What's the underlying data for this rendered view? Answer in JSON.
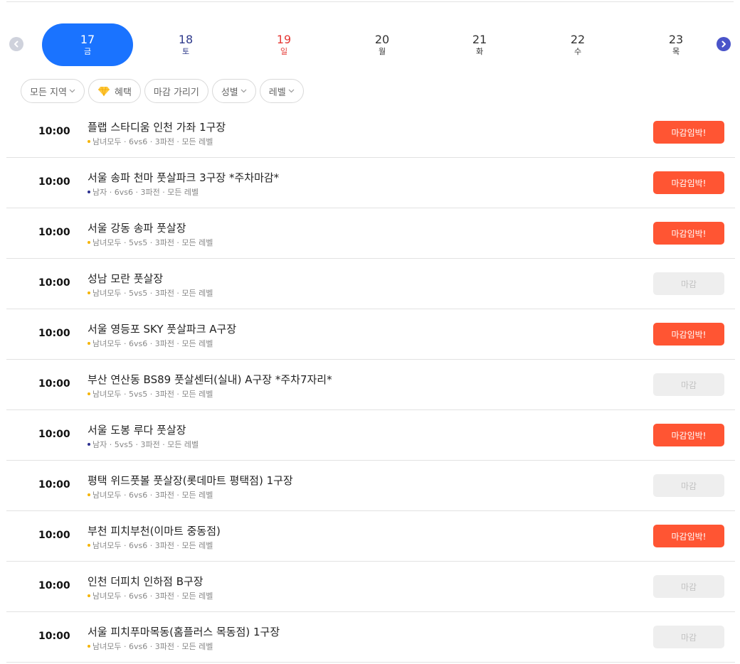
{
  "colors": {
    "selected_day": "#1a73ff",
    "saturday": "#2f3b8c",
    "sunday": "#e53935",
    "urgent": "#ff5533",
    "closed_bg": "#eeeeee",
    "mixed_dot": "#f5b400",
    "male_dot": "#2b2f8f"
  },
  "date_nav": {
    "prev_icon": "chevron-left-icon",
    "next_icon": "chevron-right-icon",
    "days": [
      {
        "num": "17",
        "weekday": "금",
        "kind": "selected"
      },
      {
        "num": "18",
        "weekday": "토",
        "kind": "sat"
      },
      {
        "num": "19",
        "weekday": "일",
        "kind": "sun"
      },
      {
        "num": "20",
        "weekday": "월",
        "kind": "normal"
      },
      {
        "num": "21",
        "weekday": "화",
        "kind": "normal"
      },
      {
        "num": "22",
        "weekday": "수",
        "kind": "normal"
      },
      {
        "num": "23",
        "weekday": "목",
        "kind": "normal"
      }
    ]
  },
  "filters": [
    {
      "label": "모든 지역",
      "icon": "chevron-down-icon"
    },
    {
      "label": "혜택",
      "icon": "diamond-icon"
    },
    {
      "label": "마감 가리기",
      "icon": ""
    },
    {
      "label": "성별",
      "icon": "chevron-down-icon"
    },
    {
      "label": "레벨",
      "icon": "chevron-down-icon"
    }
  ],
  "matches": [
    {
      "time": "10:00",
      "title": "플랩 스타디움 인천 가좌 1구장",
      "gender": "mixed",
      "meta": "남녀모두 · 6vs6 · 3파전 · 모든 레벨",
      "status": "urgent",
      "status_label": "마감임박!"
    },
    {
      "time": "10:00",
      "title": "서울 송파 천마 풋살파크 3구장 *주차마감*",
      "gender": "male",
      "meta": "남자 · 6vs6 · 3파전 · 모든 레벨",
      "status": "urgent",
      "status_label": "마감임박!"
    },
    {
      "time": "10:00",
      "title": "서울 강동 송파 풋살장",
      "gender": "mixed",
      "meta": "남녀모두 · 5vs5 · 3파전 · 모든 레벨",
      "status": "urgent",
      "status_label": "마감임박!"
    },
    {
      "time": "10:00",
      "title": "성남 모란 풋살장",
      "gender": "mixed",
      "meta": "남녀모두 · 5vs5 · 3파전 · 모든 레벨",
      "status": "closed",
      "status_label": "마감"
    },
    {
      "time": "10:00",
      "title": "서울 영등포 SKY 풋살파크 A구장",
      "gender": "mixed",
      "meta": "남녀모두 · 6vs6 · 3파전 · 모든 레벨",
      "status": "urgent",
      "status_label": "마감임박!"
    },
    {
      "time": "10:00",
      "title": "부산 연산동 BS89 풋살센터(실내) A구장 *주차7자리*",
      "gender": "mixed",
      "meta": "남녀모두 · 5vs5 · 3파전 · 모든 레벨",
      "status": "closed",
      "status_label": "마감"
    },
    {
      "time": "10:00",
      "title": "서울 도봉 루다 풋살장",
      "gender": "male",
      "meta": "남자 · 5vs5 · 3파전 · 모든 레벨",
      "status": "urgent",
      "status_label": "마감임박!"
    },
    {
      "time": "10:00",
      "title": "평택 위드풋볼 풋살장(롯데마트 평택점) 1구장",
      "gender": "mixed",
      "meta": "남녀모두 · 6vs6 · 3파전 · 모든 레벨",
      "status": "closed",
      "status_label": "마감"
    },
    {
      "time": "10:00",
      "title": "부천 피치부천(이마트 중동점)",
      "gender": "mixed",
      "meta": "남녀모두 · 6vs6 · 3파전 · 모든 레벨",
      "status": "urgent",
      "status_label": "마감임박!"
    },
    {
      "time": "10:00",
      "title": "인천 더피치 인하점 B구장",
      "gender": "mixed",
      "meta": "남녀모두 · 6vs6 · 3파전 · 모든 레벨",
      "status": "closed",
      "status_label": "마감"
    },
    {
      "time": "10:00",
      "title": "서울 피치푸마목동(홈플러스 목동점) 1구장",
      "gender": "mixed",
      "meta": "남녀모두 · 6vs6 · 3파전 · 모든 레벨",
      "status": "closed",
      "status_label": "마감"
    }
  ]
}
